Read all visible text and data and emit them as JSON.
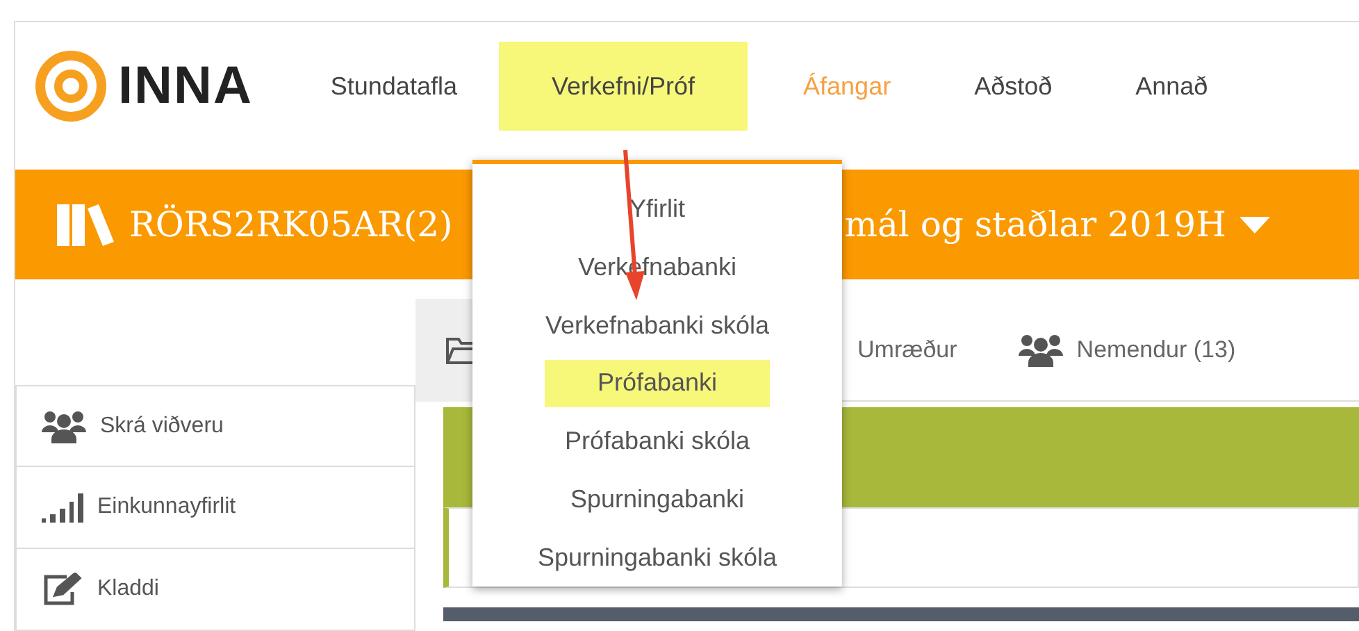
{
  "logo": {
    "text": "INNA"
  },
  "nav": [
    {
      "label": "Stundatafla",
      "selected": false,
      "current": false
    },
    {
      "label": "Verkefni/Próf",
      "selected": true,
      "current": false
    },
    {
      "label": "Áfangar",
      "selected": false,
      "current": true
    },
    {
      "label": "Aðstoð",
      "selected": false,
      "current": false
    },
    {
      "label": "Annað",
      "selected": false,
      "current": false
    }
  ],
  "course_bar": {
    "title_start": "RÖRS2RK05AR(2)",
    "title_end": "mál og staðlar 2019H"
  },
  "tabs": [
    {
      "selected": true
    },
    {
      "label": "Umræður",
      "selected": false
    },
    {
      "label": "Nemendur (13)",
      "selected": false
    }
  ],
  "sidebar": [
    {
      "label": "Skrá viðveru"
    },
    {
      "label": "Einkunnayfirlit"
    },
    {
      "label": "Kladdi"
    }
  ],
  "dropdown": {
    "items": [
      {
        "label": "Yfirlit",
        "selected": false
      },
      {
        "label": "Verkefnabanki",
        "selected": false
      },
      {
        "label": "Verkefnabanki skóla",
        "selected": false
      },
      {
        "label": "Prófabanki",
        "selected": true
      },
      {
        "label": "Prófabanki skóla",
        "selected": false
      },
      {
        "label": "Spurningabanki",
        "selected": false
      },
      {
        "label": "Spurningabanki skóla",
        "selected": false
      }
    ]
  }
}
